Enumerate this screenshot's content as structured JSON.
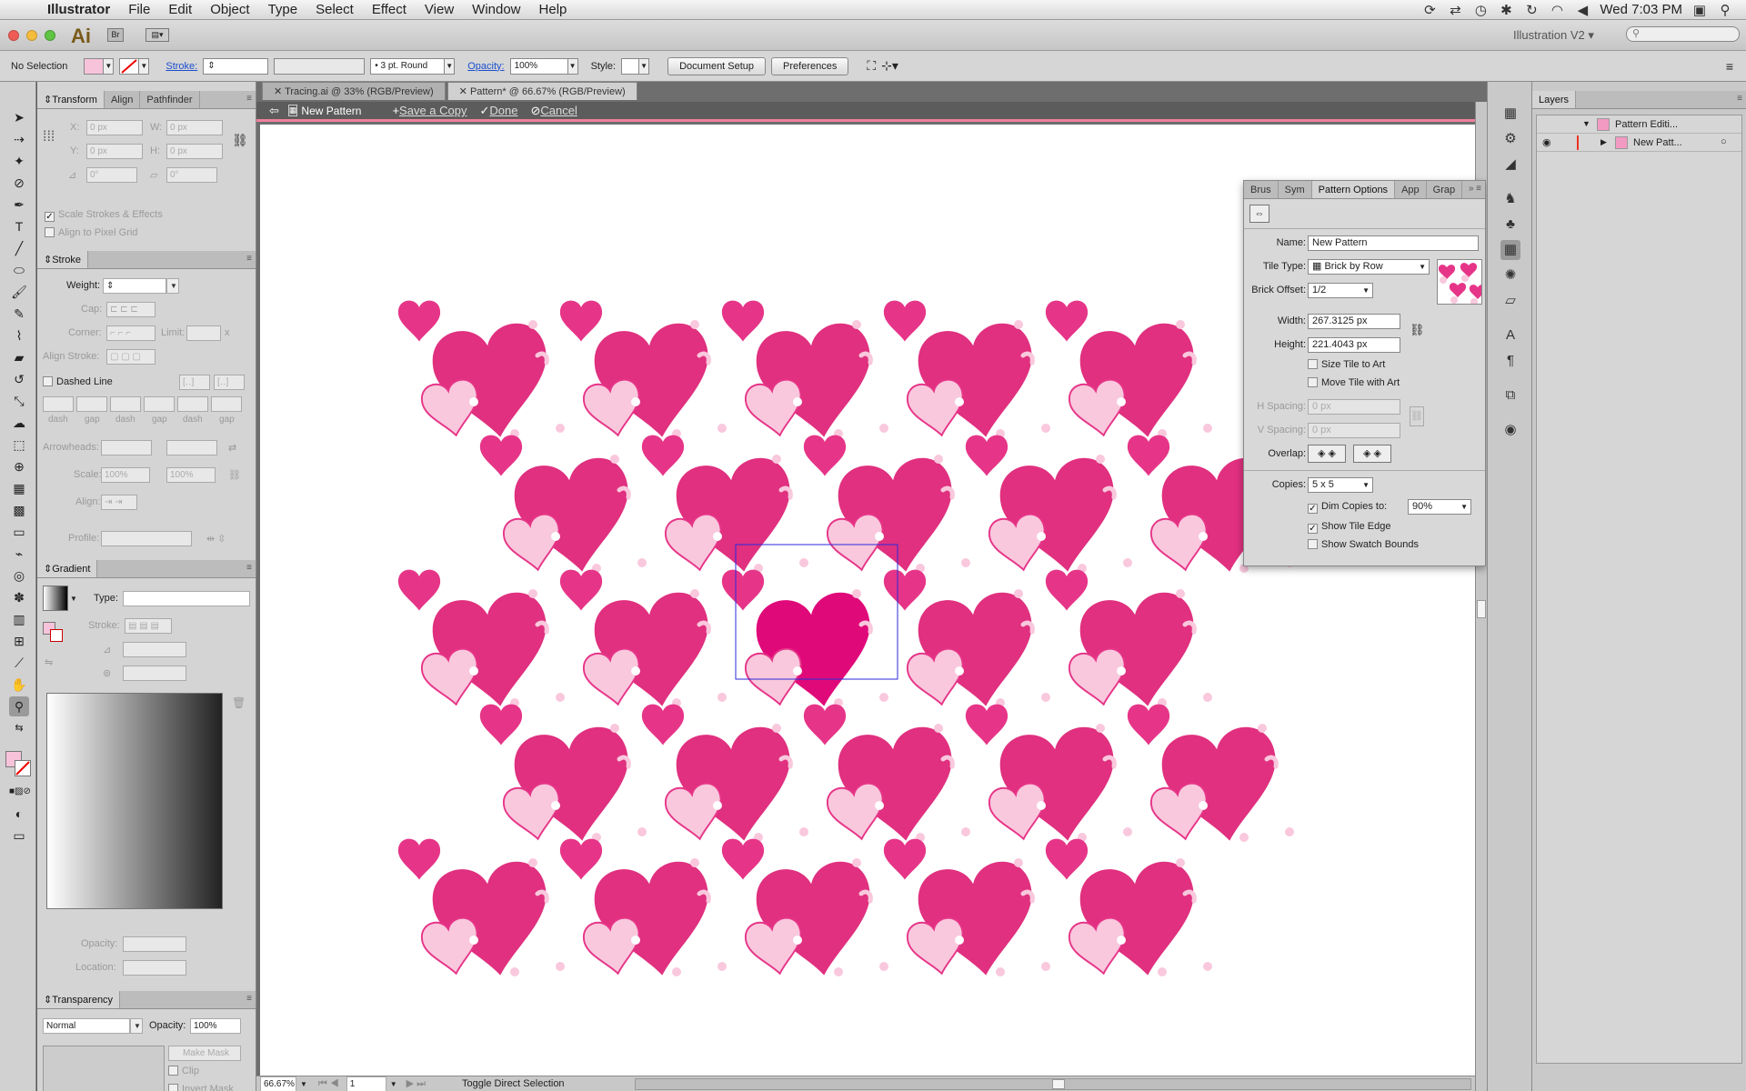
{
  "menubar": {
    "app": "Illustrator",
    "items": [
      "File",
      "Edit",
      "Object",
      "Type",
      "Select",
      "Effect",
      "View",
      "Window",
      "Help"
    ],
    "clock": "Wed 7:03 PM"
  },
  "appbar": {
    "logo": "Ai",
    "bridge": "Br",
    "workspace": "Illustration V2",
    "search_placeholder": ""
  },
  "control": {
    "selection": "No Selection",
    "stroke_label": "Stroke:",
    "brush": "3 pt. Round",
    "opacity_label": "Opacity:",
    "opacity": "100%",
    "style_label": "Style:",
    "doc_setup": "Document Setup",
    "preferences": "Preferences"
  },
  "transform": {
    "tabs": [
      "Transform",
      "Align",
      "Pathfinder"
    ],
    "x_label": "X:",
    "x": "0 px",
    "w_label": "W:",
    "w": "0 px",
    "y_label": "Y:",
    "y": "0 px",
    "h_label": "H:",
    "h": "0 px",
    "rot": "0°",
    "shear": "0°",
    "scale_strokes": "Scale Strokes & Effects",
    "align_pixel": "Align to Pixel Grid"
  },
  "stroke": {
    "title": "Stroke",
    "weight_label": "Weight:",
    "cap_label": "Cap:",
    "corner_label": "Corner:",
    "limit_label": "Limit:",
    "limit_x": "x",
    "align_label": "Align Stroke:",
    "dashed": "Dashed Line",
    "dash_labels": [
      "dash",
      "gap",
      "dash",
      "gap",
      "dash",
      "gap"
    ],
    "arrowheads_label": "Arrowheads:",
    "scale_label": "Scale:",
    "scale1": "100%",
    "scale2": "100%",
    "align2_label": "Align:",
    "profile_label": "Profile:"
  },
  "gradient": {
    "title": "Gradient",
    "type_label": "Type:",
    "stroke_label": "Stroke:",
    "opacity_label": "Opacity:",
    "location_label": "Location:"
  },
  "transparency": {
    "title": "Transparency",
    "mode": "Normal",
    "opacity_label": "Opacity:",
    "opacity": "100%",
    "make_mask": "Make Mask",
    "clip": "Clip",
    "invert": "Invert Mask"
  },
  "document": {
    "tabs": [
      "Tracing.ai @ 33% (RGB/Preview)",
      "Pattern* @ 66.67% (RGB/Preview)"
    ],
    "active_tab": 1,
    "iso_name": "New Pattern",
    "save_copy": "Save a Copy",
    "done": "Done",
    "cancel": "Cancel",
    "zoom": "66.67%",
    "artboard": "1",
    "status": "Toggle Direct Selection"
  },
  "pattern_options": {
    "tabs": [
      "Brus",
      "Sym",
      "Pattern Options",
      "App",
      "Grap"
    ],
    "name_label": "Name:",
    "name": "New Pattern",
    "tile_type_label": "Tile Type:",
    "tile_type": "Brick by Row",
    "brick_offset_label": "Brick Offset:",
    "brick_offset": "1/2",
    "width_label": "Width:",
    "width": "267.3125 px",
    "height_label": "Height:",
    "height": "221.4043 px",
    "size_tile": "Size Tile to Art",
    "move_tile": "Move Tile with Art",
    "hspacing_label": "H Spacing:",
    "hspacing": "0 px",
    "vspacing_label": "V Spacing:",
    "vspacing": "0 px",
    "overlap_label": "Overlap:",
    "copies_label": "Copies:",
    "copies": "5 x 5",
    "dim_copies": "Dim Copies to:",
    "dim_value": "90%",
    "show_tile_edge": "Show Tile Edge",
    "show_swatch_bounds": "Show Swatch Bounds"
  },
  "layers": {
    "title": "Layers",
    "rows": [
      "Pattern Editi...",
      "New Patt..."
    ]
  },
  "colors": {
    "heart_dark": "#e0307f",
    "heart_main": "#e63588",
    "heart_light": "#f9c8dd",
    "heart_center": "#e0097a",
    "accent": "#f07f9d"
  }
}
